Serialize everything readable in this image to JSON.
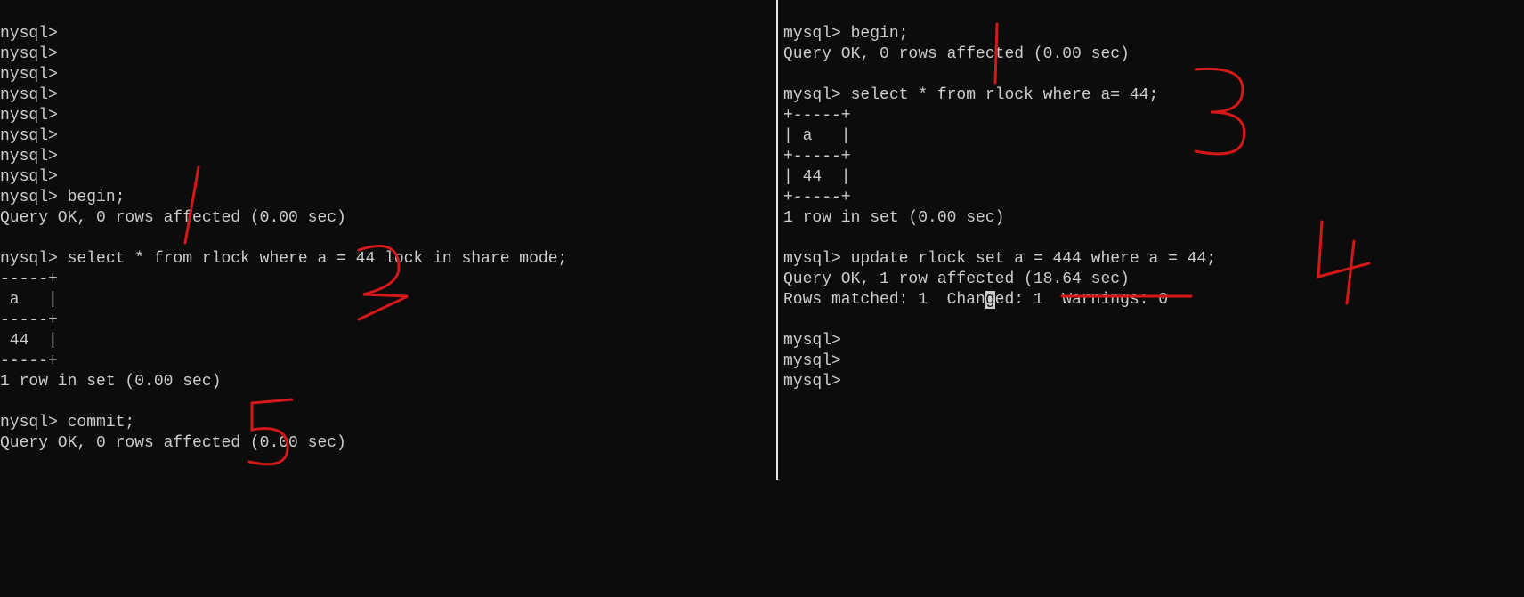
{
  "left": {
    "lines": [
      "nysql>",
      "nysql>",
      "nysql>",
      "nysql>",
      "nysql>",
      "nysql>",
      "nysql>",
      "nysql>",
      "nysql> begin;",
      "Query OK, 0 rows affected (0.00 sec)",
      "",
      "nysql> select * from rlock where a = 44 lock in share mode;",
      "-----+",
      " a   |",
      "-----+",
      " 44  |",
      "-----+",
      "1 row in set (0.00 sec)",
      "",
      "nysql> commit;",
      "Query OK, 0 rows affected (0.00 sec)"
    ]
  },
  "right": {
    "lines": [
      "mysql> begin;",
      "Query OK, 0 rows affected (0.00 sec)",
      "",
      "mysql> select * from rlock where a= 44;",
      "+-----+",
      "| a   |",
      "+-----+",
      "| 44  |",
      "+-----+",
      "1 row in set (0.00 sec)",
      "",
      "mysql> update rlock set a = 444 where a = 44;",
      "Query OK, 1 row affected (18.64 sec)",
      "Rows matched: 1  Changed: 1  Warnings: 0",
      "",
      "mysql>",
      "mysql>",
      "mysql>"
    ],
    "highlight": {
      "line": 13,
      "before": "Rows matched: 1  Chan",
      "char": "g",
      "after": "ed: 1  Warnings: 0"
    }
  },
  "annotations": {
    "color": "#d41818"
  }
}
